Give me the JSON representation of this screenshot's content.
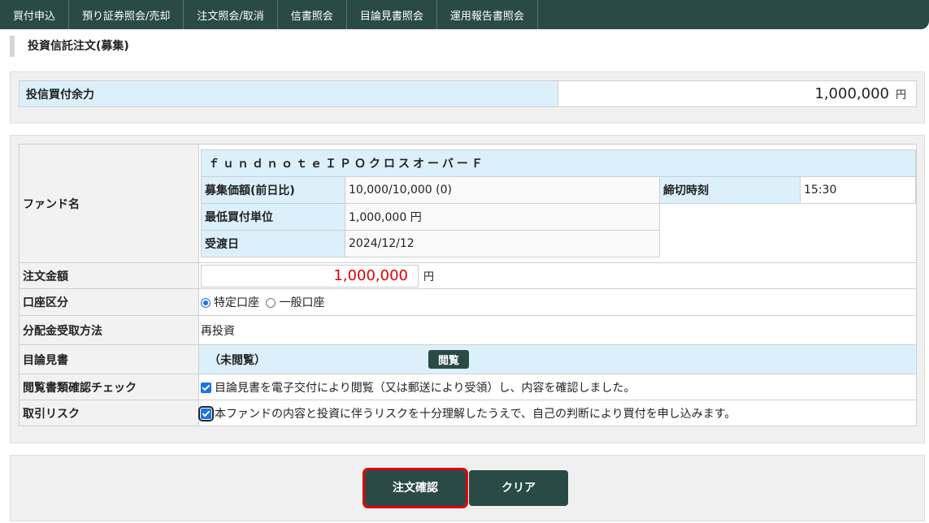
{
  "nav": {
    "items": [
      "買付申込",
      "預り証券照会/売却",
      "注文照会/取消",
      "信書照会",
      "目論見書照会",
      "運用報告書照会"
    ]
  },
  "page": {
    "title": "投資信託注文(募集)"
  },
  "balance": {
    "label": "投信買付余力",
    "value": "1,000,000",
    "unit": "円"
  },
  "fund": {
    "row_label": "ファンド名",
    "name": "ｆｕｎｄｎｏｔｅＩＰＯクロスオーバーＦ",
    "price_label": "募集価額(前日比)",
    "price_value": "10,000/10,000 (0)",
    "deadline_label": "締切時刻",
    "deadline_value": "15:30",
    "min_unit_label": "最低買付単位",
    "min_unit_value": "1,000,000 円",
    "delivery_label": "受渡日",
    "delivery_value": "2024/12/12"
  },
  "order": {
    "amount_label": "注文金額",
    "amount_value": "1,000,000",
    "amount_unit": "円",
    "account_label": "口座区分",
    "account_options": [
      "特定口座",
      "一般口座"
    ],
    "account_selected": "特定口座",
    "dividend_label": "分配金受取方法",
    "dividend_value": "再投資",
    "prospectus_label": "目論見書",
    "prospectus_status": "（未閲覧）",
    "prospectus_button": "閲覧",
    "check_label": "閲覧書類確認チェック",
    "check_text": "目論見書を電子交付により閲覧（又は郵送により受領）し、内容を確認しました。",
    "risk_label": "取引リスク",
    "risk_text": "本ファンドの内容と投資に伴うリスクを十分理解したうえで、自己の判断により買付を申し込みます。"
  },
  "actions": {
    "confirm": "注文確認",
    "clear": "クリア"
  },
  "colors": {
    "nav_bg": "#2a4a46",
    "header_cell": "#dcf0fb",
    "amount_text": "#e00000",
    "highlight_border": "#e00000"
  }
}
